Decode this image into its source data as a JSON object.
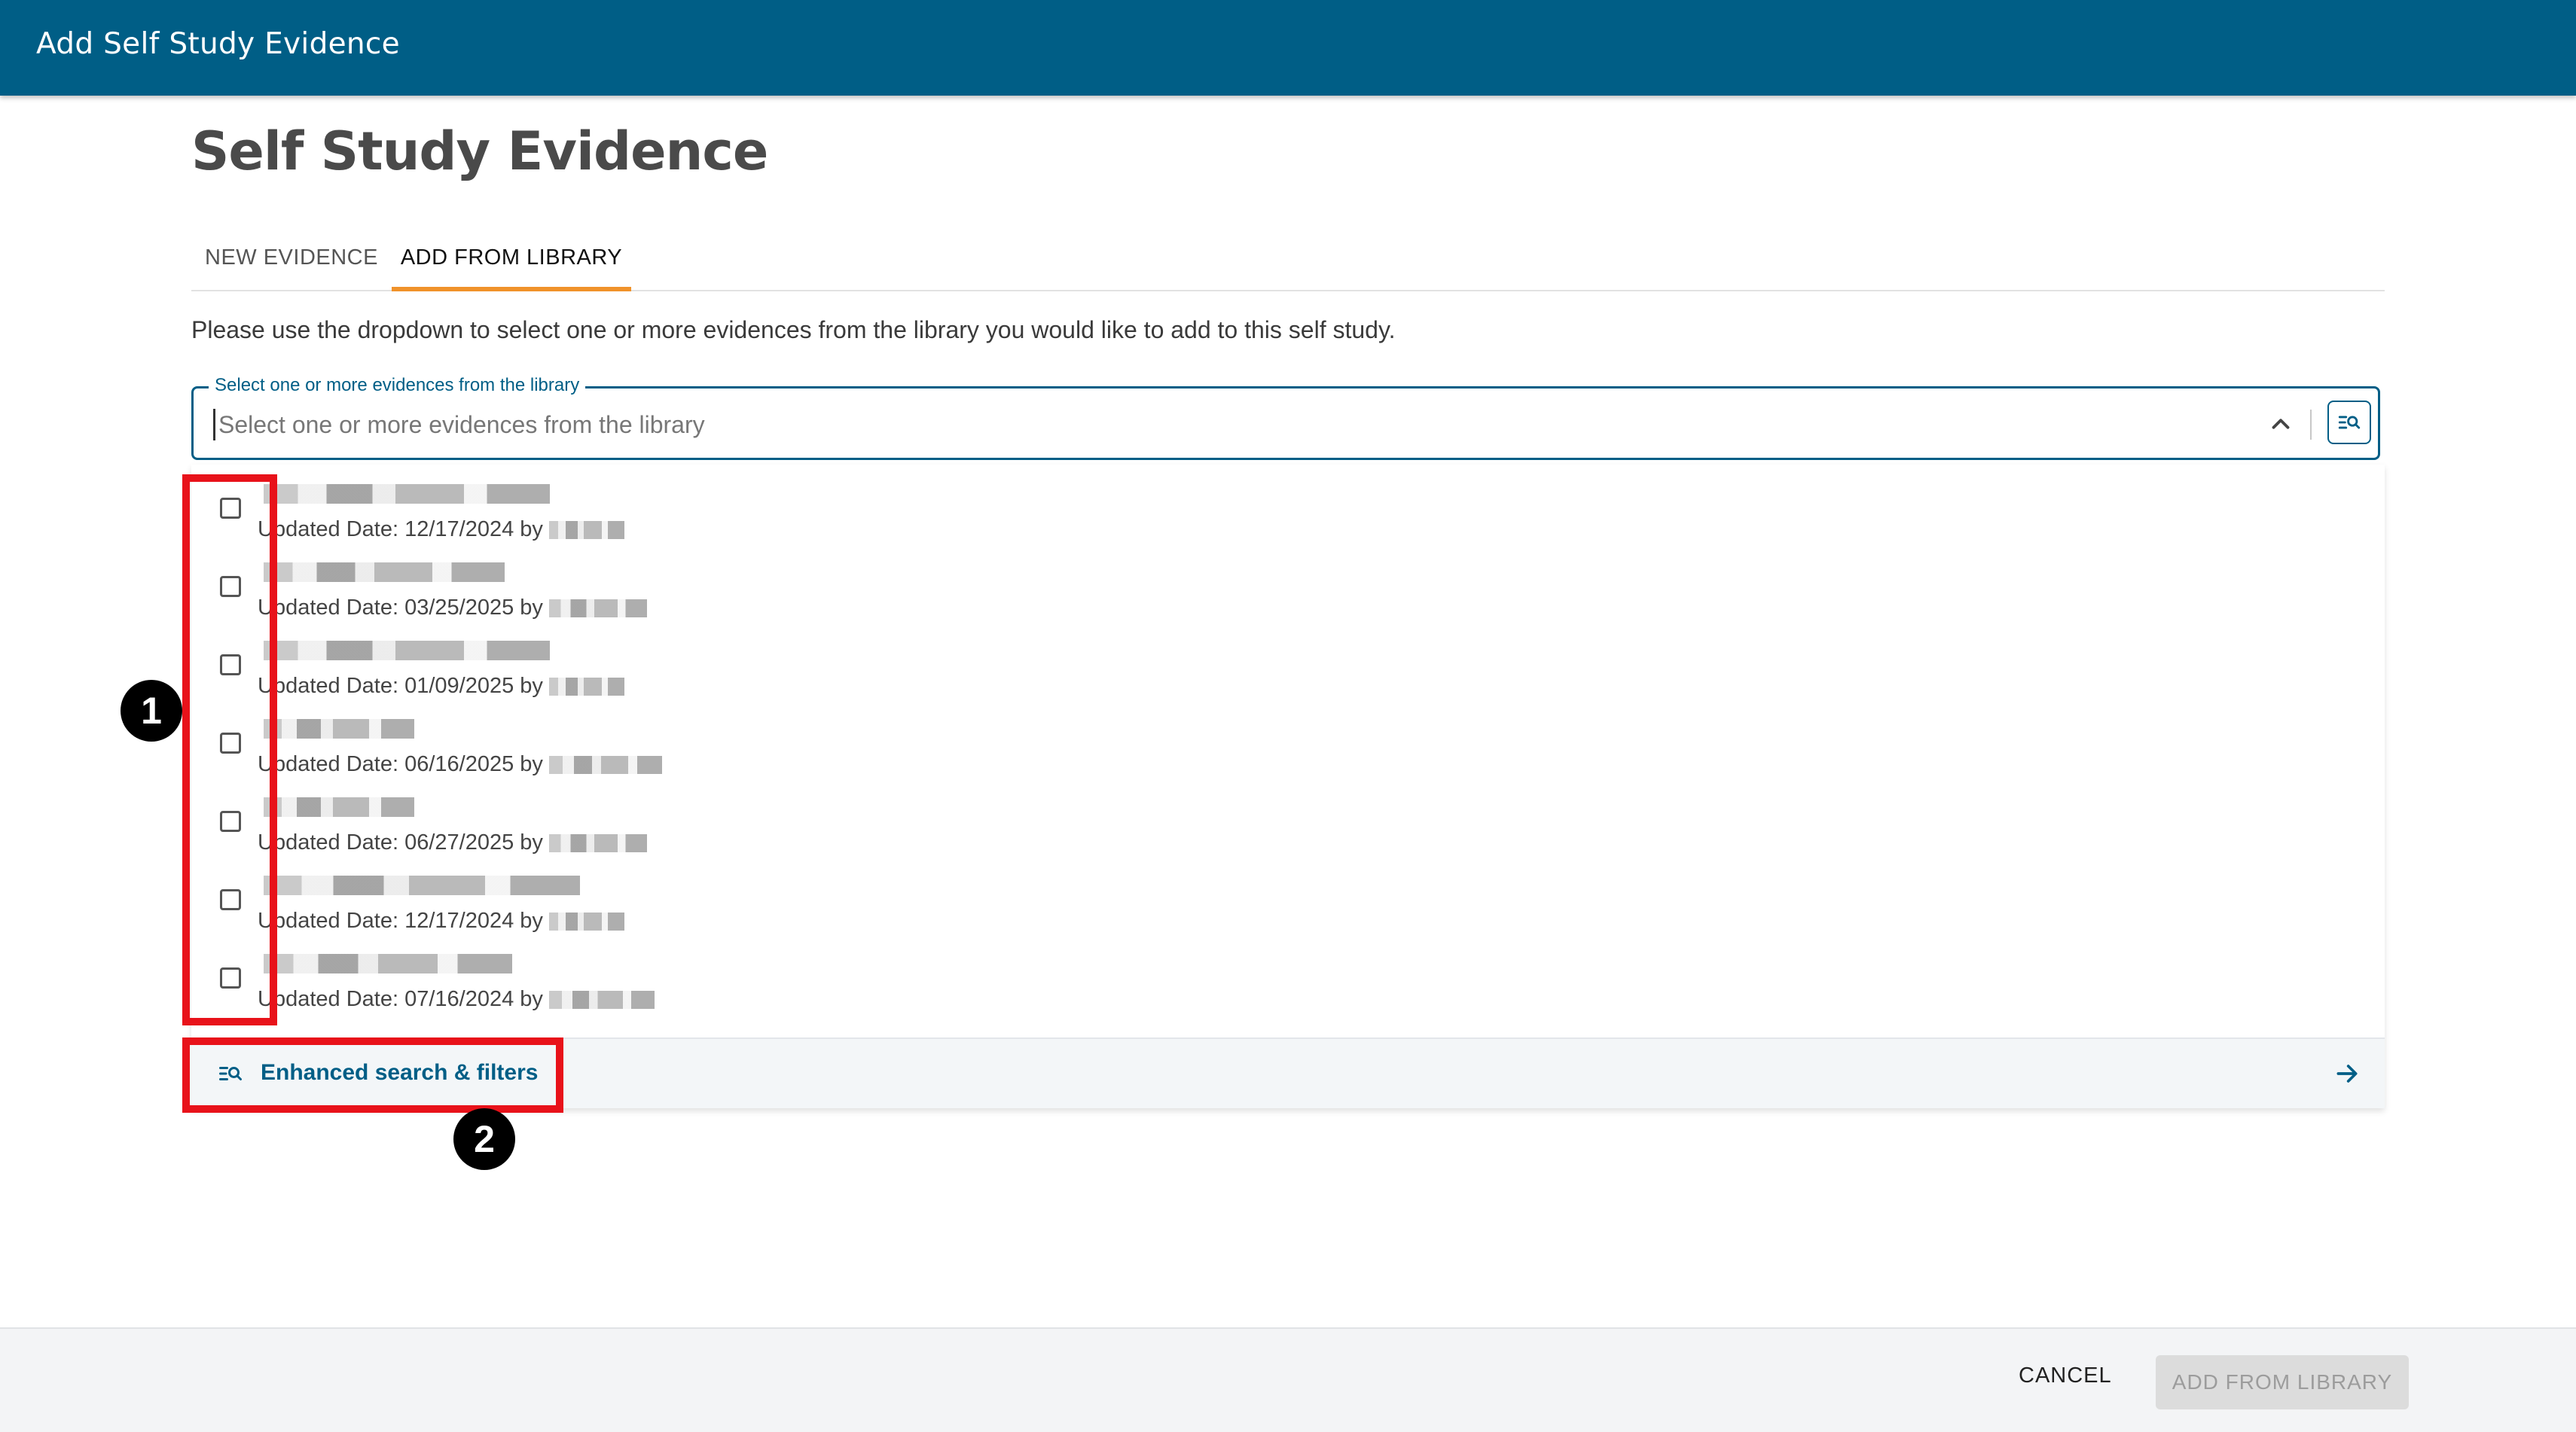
{
  "app_bar": {
    "title": "Add Self Study Evidence"
  },
  "page": {
    "title": "Self Study Evidence"
  },
  "tabs": [
    {
      "label": "NEW EVIDENCE",
      "active": false
    },
    {
      "label": "ADD FROM LIBRARY",
      "active": true
    }
  ],
  "instructions": "Please use the dropdown to select one or more evidences from the library you would like to add to this self study.",
  "select": {
    "label": "Select one or more evidences from the library",
    "placeholder": "Select one or more evidences from the library",
    "value": ""
  },
  "evidence_items": [
    {
      "title": "",
      "meta": "Updated Date: 12/17/2024 by",
      "checked": false
    },
    {
      "title": "",
      "meta": "Updated Date: 03/25/2025 by",
      "checked": false
    },
    {
      "title": "",
      "meta": "Updated Date: 01/09/2025 by",
      "checked": false
    },
    {
      "title": "",
      "meta": "Updated Date: 06/16/2025 by",
      "checked": false
    },
    {
      "title": "",
      "meta": "Updated Date: 06/27/2025 by",
      "checked": false
    },
    {
      "title": "",
      "meta": "Updated Date: 12/17/2024 by",
      "checked": false
    },
    {
      "title": "",
      "meta": "Updated Date: 07/16/2024 by",
      "checked": false
    }
  ],
  "enhanced_search": {
    "label": "Enhanced search & filters"
  },
  "annotations": [
    {
      "label": "1"
    },
    {
      "label": "2"
    }
  ],
  "footer": {
    "cancel_label": "CANCEL",
    "add_label": "ADD FROM LIBRARY",
    "add_enabled": false
  },
  "colors": {
    "primary": "#005e86",
    "tab_indicator": "#f0922a",
    "annotation": "#e8121a"
  },
  "icons": {
    "chevron": "chevron-up-icon",
    "search": "enhanced-search-icon",
    "arrow": "arrow-right-icon"
  }
}
